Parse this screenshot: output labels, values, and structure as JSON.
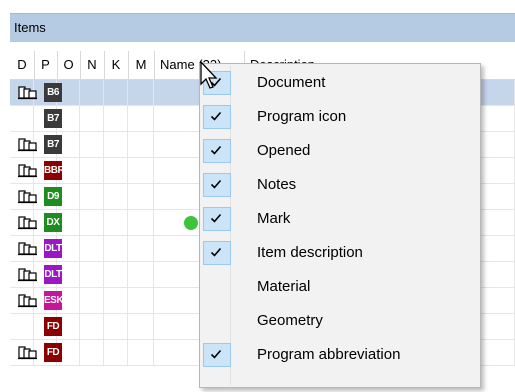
{
  "panel": {
    "title": "Items"
  },
  "columns": [
    {
      "key": "D",
      "label": "D"
    },
    {
      "key": "P",
      "label": "P"
    },
    {
      "key": "O",
      "label": "O"
    },
    {
      "key": "N",
      "label": "N"
    },
    {
      "key": "K",
      "label": "K"
    },
    {
      "key": "M",
      "label": "M"
    },
    {
      "key": "name",
      "label": "Name (23)"
    },
    {
      "key": "description",
      "label": "Description"
    }
  ],
  "rows": [
    {
      "doc": true,
      "program": "B6",
      "program_color": "#3a3a3a",
      "mark": false,
      "selected": true
    },
    {
      "doc": false,
      "program": "B7",
      "program_color": "#3a3a3a",
      "mark": false
    },
    {
      "doc": true,
      "program": "B7",
      "program_color": "#3a3a3a",
      "mark": false
    },
    {
      "doc": true,
      "program": "BBR",
      "program_color": "#8b0000",
      "mark": false
    },
    {
      "doc": true,
      "program": "D9",
      "program_color": "#1f8c1f",
      "mark": false
    },
    {
      "doc": true,
      "program": "DX",
      "program_color": "#1f8c1f",
      "mark": true
    },
    {
      "doc": true,
      "program": "DLT",
      "program_color": "#9b16c7",
      "mark": false
    },
    {
      "doc": true,
      "program": "DLT",
      "program_color": "#9b16c7",
      "mark": false
    },
    {
      "doc": true,
      "program": "ESK",
      "program_color": "#c5169a",
      "mark": false
    },
    {
      "doc": false,
      "program": "FD",
      "program_color": "#8b0000",
      "mark": false
    },
    {
      "doc": true,
      "program": "FD",
      "program_color": "#8b0000",
      "mark": false
    }
  ],
  "context_menu": {
    "items": [
      {
        "label": "Document",
        "checked": true
      },
      {
        "label": "Program icon",
        "checked": true
      },
      {
        "label": "Opened",
        "checked": true
      },
      {
        "label": "Notes",
        "checked": true
      },
      {
        "label": "Mark",
        "checked": true
      },
      {
        "label": "Item description",
        "checked": true
      },
      {
        "label": "Material",
        "checked": false
      },
      {
        "label": "Geometry",
        "checked": false
      },
      {
        "label": "Program abbreviation",
        "checked": true
      }
    ]
  },
  "colors": {
    "header_bar": "#b5cbe3",
    "selected_row": "#c5d5ea",
    "mark_green": "#3cc43c",
    "check_bg": "#cce4f7"
  }
}
